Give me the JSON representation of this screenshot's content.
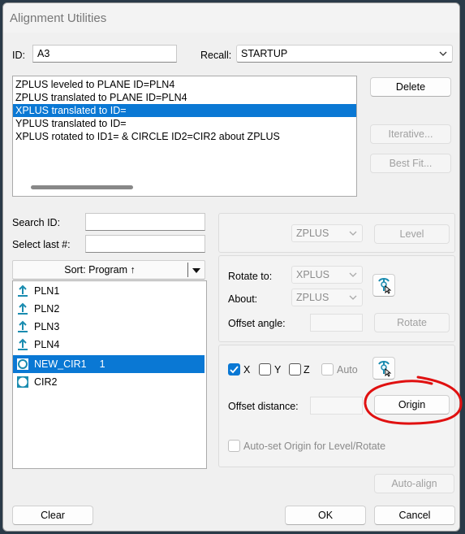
{
  "window": {
    "title": "Alignment Utilities"
  },
  "id_field": {
    "label": "ID:",
    "value": "A3"
  },
  "recall": {
    "label": "Recall:",
    "value": "STARTUP"
  },
  "steps": [
    "ZPLUS leveled to PLANE ID=PLN4",
    "ZPLUS translated to PLANE ID=PLN4",
    "XPLUS translated to  ID=",
    "YPLUS translated to  ID=",
    "XPLUS rotated to  ID1= & CIRCLE ID2=CIR2 about ZPLUS"
  ],
  "selected_step": 2,
  "right_buttons": {
    "delete": "Delete",
    "iterative": "Iterative...",
    "best_fit": "Best Fit..."
  },
  "search": {
    "label": "Search ID:",
    "value": ""
  },
  "select_last": {
    "label": "Select last #:",
    "value": ""
  },
  "sort": {
    "label": "Sort: Program ↑"
  },
  "features": [
    {
      "name": "PLN1",
      "type": "plane",
      "extra": ""
    },
    {
      "name": "PLN2",
      "type": "plane",
      "extra": ""
    },
    {
      "name": "PLN3",
      "type": "plane",
      "extra": ""
    },
    {
      "name": "PLN4",
      "type": "plane",
      "extra": ""
    },
    {
      "name": "NEW_CIR1",
      "type": "circle",
      "extra": "1"
    },
    {
      "name": "CIR2",
      "type": "circle",
      "extra": ""
    }
  ],
  "selected_feature": 4,
  "level": {
    "axis": "ZPLUS",
    "button": "Level"
  },
  "rotate": {
    "rotate_to_label": "Rotate to:",
    "rotate_to_value": "XPLUS",
    "about_label": "About:",
    "about_value": "ZPLUS",
    "offset_label": "Offset angle:",
    "offset_value": "",
    "button": "Rotate"
  },
  "origin": {
    "x_label": "X",
    "x_checked": true,
    "y_label": "Y",
    "y_checked": false,
    "z_label": "Z",
    "z_checked": false,
    "auto_label": "Auto",
    "auto_checked": false,
    "offset_label": "Offset distance:",
    "offset_value": "",
    "button": "Origin"
  },
  "auto_set": {
    "label": "Auto-set Origin for Level/Rotate",
    "checked": false
  },
  "auto_align": "Auto-align",
  "bottom": {
    "clear": "Clear",
    "ok": "OK",
    "cancel": "Cancel"
  },
  "colors": {
    "selection": "#0a78d4",
    "annotation": "#e01010",
    "feature_icon": "#1a8cb0"
  }
}
